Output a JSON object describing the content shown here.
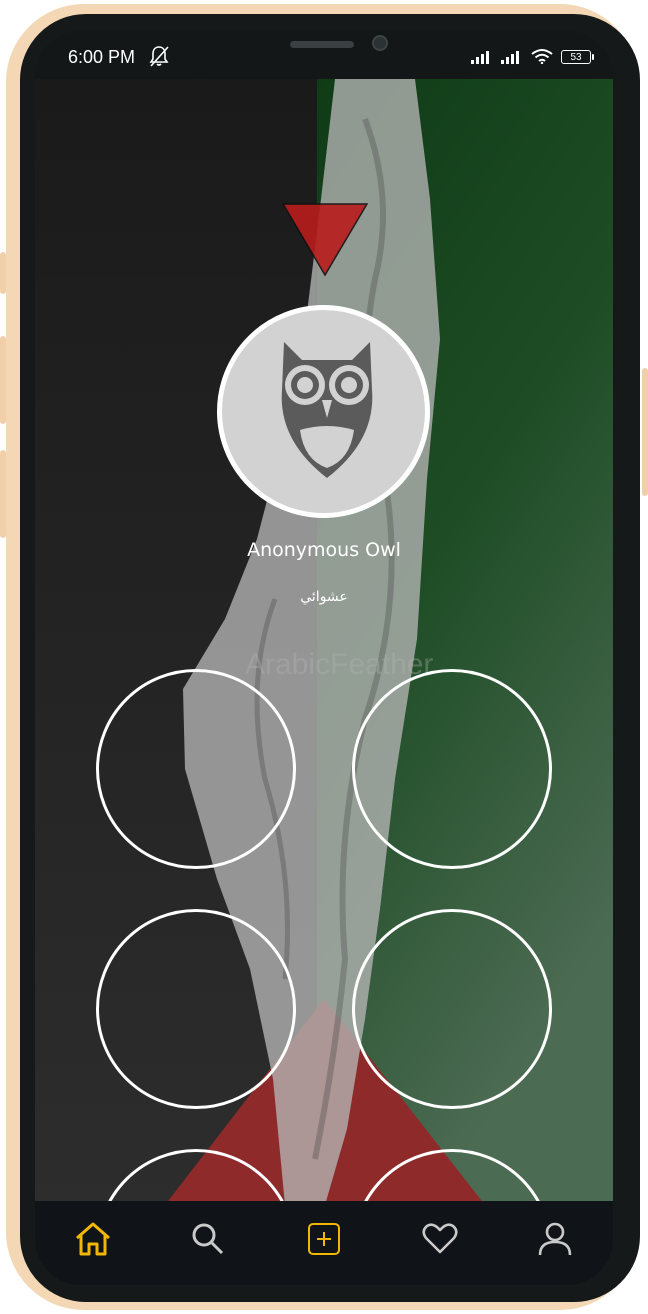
{
  "status_bar": {
    "time": "6:00 PM",
    "battery": "53"
  },
  "profile": {
    "name": "Anonymous Owl",
    "tag": "عشوائي"
  },
  "watermark": "ArabicFeather",
  "bottom_nav": {
    "active": "home"
  },
  "colors": {
    "accent": "#f2b705",
    "flag_green": "#0f3b16",
    "flag_red": "#b81c1c",
    "flag_black": "#1a1a1a",
    "frame": "#f4d7b5"
  }
}
